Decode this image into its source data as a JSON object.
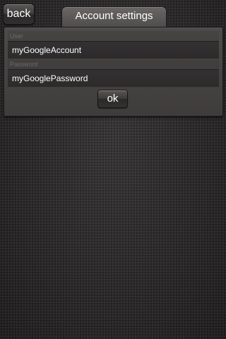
{
  "header": {
    "back_label": "back",
    "title": "Account settings"
  },
  "form": {
    "user": {
      "label": "User",
      "value": "myGoogleAccount"
    },
    "password": {
      "label": "Password",
      "value": "myGooglePassword"
    },
    "ok_label": "ok"
  },
  "colors": {
    "background": "#2f2d2d",
    "panel": "#4d4a4a",
    "text": "#ffffff",
    "label_text": "#6d6969"
  }
}
